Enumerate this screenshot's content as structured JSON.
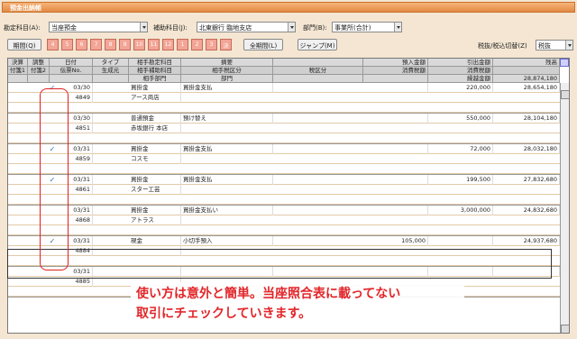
{
  "window": {
    "title": "預金出納帳"
  },
  "filters": {
    "account_label": "勘定科目(A):",
    "account_value": "当座預金",
    "sub_label": "補助科目(J):",
    "sub_value": "北東銀行 臨地支店",
    "dept_label": "部門(B):",
    "dept_value": "事業所(合計)"
  },
  "toolbar": {
    "period_label": "期間(Q)",
    "months": [
      "4",
      "5",
      "6",
      "7",
      "8",
      "9",
      "10",
      "11",
      "12",
      "1",
      "2",
      "3",
      "決"
    ],
    "all_period_label": "全期間(L)",
    "jump_label": "ジャンプ(M)",
    "tax_label": "税抜/税込切替(Z)",
    "tax_value": "税抜"
  },
  "headers": {
    "r1": [
      "決算",
      "調整",
      "日付",
      "タイプ",
      "相手勘定科目",
      "摘要",
      "",
      "預入金額",
      "引出金額",
      "残高"
    ],
    "r2": [
      "付箋1",
      "付箋2",
      "伝票No.",
      "生成元",
      "相手補助科目",
      "相手税区分",
      "税区分",
      "消費税額",
      "消費税額",
      ""
    ],
    "r3": [
      "",
      "",
      "",
      "",
      "相手部門",
      "部門",
      "",
      "",
      "繰越金額",
      "28,874,180"
    ]
  },
  "records": [
    {
      "checked": true,
      "date": "03/30",
      "no": "4849",
      "acct": "買掛金",
      "sub": "アース商店",
      "memo": "買掛金支払",
      "deposit": "",
      "withdraw": "220,000",
      "balance": "28,654,180"
    },
    {
      "checked": false,
      "date": "03/30",
      "no": "4851",
      "acct": "普通預金",
      "sub": "赤坂銀行 本店",
      "memo": "預け替え",
      "deposit": "",
      "withdraw": "550,000",
      "balance": "28,104,180"
    },
    {
      "checked": true,
      "date": "03/31",
      "no": "4859",
      "acct": "買掛金",
      "sub": "コスモ",
      "memo": "買掛金支払",
      "deposit": "",
      "withdraw": "72,000",
      "balance": "28,032,180"
    },
    {
      "checked": true,
      "date": "03/31",
      "no": "4861",
      "acct": "買掛金",
      "sub": "スター工芸",
      "memo": "買掛金支払",
      "deposit": "",
      "withdraw": "199,500",
      "balance": "27,832,680"
    },
    {
      "checked": false,
      "date": "03/31",
      "no": "4868",
      "acct": "買掛金",
      "sub": "アトラス",
      "memo": "買掛金支払い",
      "deposit": "",
      "withdraw": "3,000,000",
      "balance": "24,832,680"
    },
    {
      "checked": true,
      "date": "03/31",
      "no": "4884",
      "acct": "現金",
      "sub": "",
      "memo": "小切手預入",
      "deposit": "105,000",
      "withdraw": "",
      "balance": "24,937,680"
    },
    {
      "checked": false,
      "date": "03/31",
      "no": "4885",
      "acct": "",
      "sub": "",
      "memo": "",
      "deposit": "",
      "withdraw": "",
      "balance": ""
    }
  ],
  "callout": {
    "line1": "使い方は意外と簡単。当座照合表に載ってない",
    "line2": "取引にチェックしていきます。"
  },
  "colors": {
    "title": "#e38a44",
    "check": "#2a6fb5",
    "annotation": "#e02020"
  }
}
